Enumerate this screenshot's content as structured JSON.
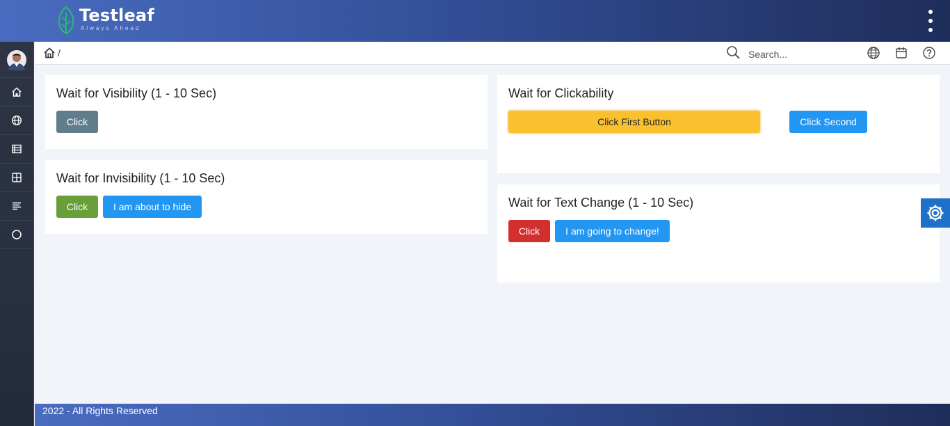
{
  "header": {
    "brand": "Testleaf",
    "tagline": "Always Ahead"
  },
  "sidebar": {
    "items": [
      {
        "icon": "home-icon"
      },
      {
        "icon": "globe-icon"
      },
      {
        "icon": "table-icon"
      },
      {
        "icon": "grid-icon"
      },
      {
        "icon": "list-icon"
      },
      {
        "icon": "circle-icon"
      }
    ]
  },
  "breadcrumb": {
    "separator": "/"
  },
  "search": {
    "placeholder": "Search..."
  },
  "cards": {
    "visibility": {
      "title": "Wait for Visibility (1 - 10 Sec)",
      "click_label": "Click"
    },
    "invisibility": {
      "title": "Wait for Invisibility (1 - 10 Sec)",
      "click_label": "Click",
      "hide_label": "I am about to hide"
    },
    "clickability": {
      "title": "Wait for Clickability",
      "first_label": "Click First Button",
      "second_label": "Click Second"
    },
    "text_change": {
      "title": "Wait for Text Change (1 - 10 Sec)",
      "click_label": "Click",
      "change_label": "I am going to change!"
    }
  },
  "footer": {
    "text": "2022 - All Rights Reserved"
  },
  "colors": {
    "grey": "#607d8b",
    "green": "#689f38",
    "blue": "#2196f3",
    "red": "#d32f2f",
    "yellow": "#fbc02d",
    "settings": "#1e70c9"
  }
}
